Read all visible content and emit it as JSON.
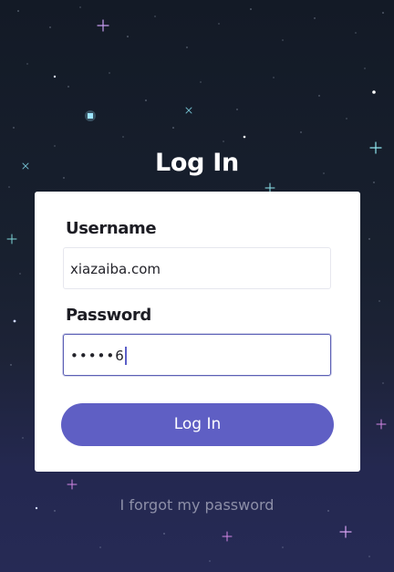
{
  "title": "Log In",
  "form": {
    "username_label": "Username",
    "username_value": "xiazaiba.com",
    "password_label": "Password",
    "password_mask": "•••••",
    "password_last_char": "6",
    "submit_label": "Log In"
  },
  "forgot_link": "I forgot my password",
  "colors": {
    "accent": "#5f5fc4",
    "background_top": "#131a26",
    "background_bottom": "#262a55",
    "card": "#ffffff",
    "link": "#8d8fa8"
  }
}
